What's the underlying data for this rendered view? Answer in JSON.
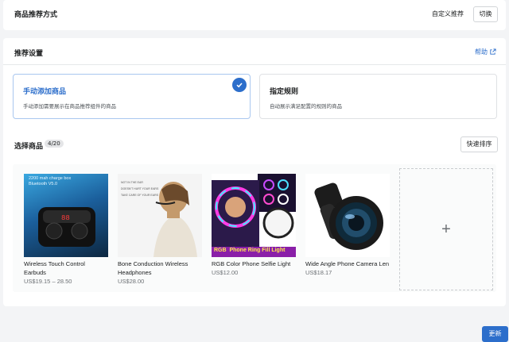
{
  "header": {
    "title": "商品推荐方式",
    "current_mode": "自定义推荐",
    "switch_label": "切换"
  },
  "settings": {
    "title": "推荐设置",
    "help_label": "帮助",
    "options": [
      {
        "title": "手动添加商品",
        "desc": "手动添加需要展示在商品推荐组件的商品",
        "selected": true
      },
      {
        "title": "指定规则",
        "desc": "自动展示满足配置的规则的商品",
        "selected": false
      }
    ]
  },
  "products_section": {
    "title": "选择商品",
    "count": "4/20",
    "sort_label": "快速排序",
    "items": [
      {
        "name": "Wireless Touch Control Earbuds",
        "price": "US$19.15 – 28.50",
        "image_text": "2200 mah charge box\nBluetooth V5.0"
      },
      {
        "name": "Bone Conduction Wireless Headphones",
        "price": "US$28.00",
        "image_text": "NOT IN THE EAR\nDOESN'T HURT YOUR EARS\nTAKE CARE OF YOUR EARS"
      },
      {
        "name": "RGB Color Phone Selfie Light",
        "price": "US$12.00",
        "image_text": "RGB  Phone Ring Fill Light"
      },
      {
        "name": "Wide Angle Phone Camera Len",
        "price": "US$18.17",
        "image_text": ""
      }
    ],
    "add_symbol": "+"
  },
  "footer": {
    "update_label": "更新"
  },
  "colors": {
    "accent": "#2c6ecb",
    "background": "#f3f4f6"
  }
}
